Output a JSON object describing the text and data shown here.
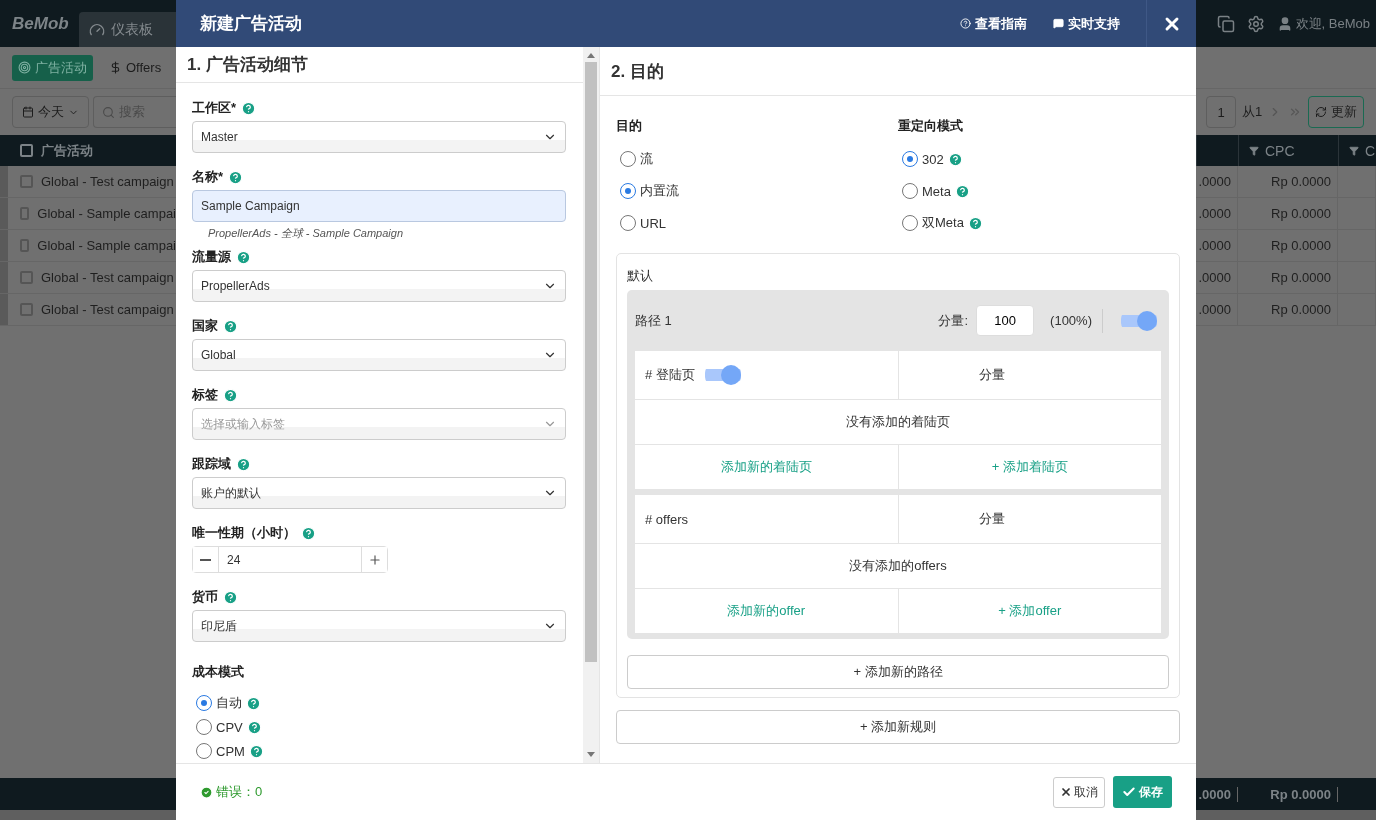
{
  "background": {
    "brand": "BeMob",
    "nav_tab": "仪表板",
    "subnav": [
      {
        "label": "广告活动",
        "selected": true
      },
      {
        "label": "Offers",
        "selected": false
      }
    ],
    "date_filter": "今天",
    "search_placeholder": "搜索",
    "table_header": "广告活动",
    "select_all_checked": false,
    "rows": [
      {
        "name": "Global - Test campaign",
        "checked": false
      },
      {
        "name": "Global - Sample campai",
        "checked": false
      },
      {
        "name": "Global - Sample campai",
        "checked": false
      },
      {
        "name": "Global - Test campaign",
        "checked": false
      },
      {
        "name": "Global - Test campaign",
        "checked": false
      }
    ],
    "user": "欢迎, BeMob",
    "page": "1",
    "page_total": "从1",
    "refresh": "更新",
    "columns": [
      "",
      "CPC",
      "C"
    ],
    "right_rows": [
      [
        ".0000",
        "Rp 0.0000"
      ],
      [
        ".0000",
        "Rp 0.0000"
      ],
      [
        ".0000",
        "Rp 0.0000"
      ],
      [
        ".0000",
        "Rp 0.0000"
      ],
      [
        ".0000",
        "Rp 0.0000"
      ]
    ],
    "footer": [
      ".0000",
      "Rp 0.0000"
    ]
  },
  "modal": {
    "title": "新建广告活动",
    "links": [
      {
        "kind": "guide",
        "label": "查看指南"
      },
      {
        "kind": "chat",
        "label": "实时支持"
      }
    ],
    "details": {
      "heading": "1. 广告活动细节",
      "fields": [
        {
          "kind": "select",
          "label": "工作区*",
          "help": true,
          "value": "Master"
        },
        {
          "kind": "text",
          "label": "名称*",
          "help": true,
          "value": "Sample Campaign",
          "hint": "PropellerAds - 全球 - Sample Campaign"
        },
        {
          "kind": "select",
          "label": "流量源",
          "help": true,
          "value": "PropellerAds"
        },
        {
          "kind": "select",
          "label": "国家",
          "help": true,
          "value": "Global"
        },
        {
          "kind": "tags",
          "label": "标签",
          "help": true,
          "placeholder": "选择或输入标签"
        },
        {
          "kind": "select",
          "label": "跟踪域",
          "help": true,
          "value": "账户的默认"
        },
        {
          "kind": "stepper",
          "label": "唯一性期（小时）",
          "help": true,
          "value": "24"
        },
        {
          "kind": "select",
          "label": "货币",
          "help": true,
          "value": "印尼盾"
        }
      ],
      "cost_model": {
        "label": "成本模式",
        "options": [
          {
            "label": "自动",
            "help": true,
            "selected": true
          },
          {
            "label": "CPV",
            "help": true,
            "selected": false
          },
          {
            "label": "CPM",
            "help": true,
            "selected": false
          }
        ]
      }
    },
    "destination": {
      "heading": "2. 目的",
      "goal": {
        "label": "目的",
        "options": [
          {
            "label": "流",
            "selected": false
          },
          {
            "label": "内置流",
            "selected": true
          },
          {
            "label": "URL",
            "selected": false
          }
        ]
      },
      "redirect": {
        "label": "重定向模式",
        "options": [
          {
            "label": "302",
            "help": true,
            "selected": true
          },
          {
            "label": "Meta",
            "help": true,
            "selected": false
          },
          {
            "label": "双Meta",
            "help": true,
            "selected": false
          }
        ]
      },
      "rule": {
        "title": "默认",
        "paths": [
          {
            "name": "路径 1",
            "weight_label": "分量:",
            "weight": "100",
            "percent": "(100%)",
            "on": true,
            "sections": [
              {
                "heading": "# 登陆页",
                "on": true,
                "weight_label": "分量",
                "empty": "没有添加的着陆页",
                "add_new": "添加新的着陆页",
                "add": "+ 添加着陆页"
              },
              {
                "heading": "# offers",
                "weight_label": "分量",
                "empty": "没有添加的offers",
                "add_new": "添加新的offer",
                "add": "+ 添加offer"
              }
            ]
          }
        ],
        "add_path": "+ 添加新的路径"
      },
      "add_rule": "+ 添加新规则"
    },
    "footer": {
      "errors": "错误：0",
      "cancel": "取消",
      "save": "保存"
    }
  }
}
